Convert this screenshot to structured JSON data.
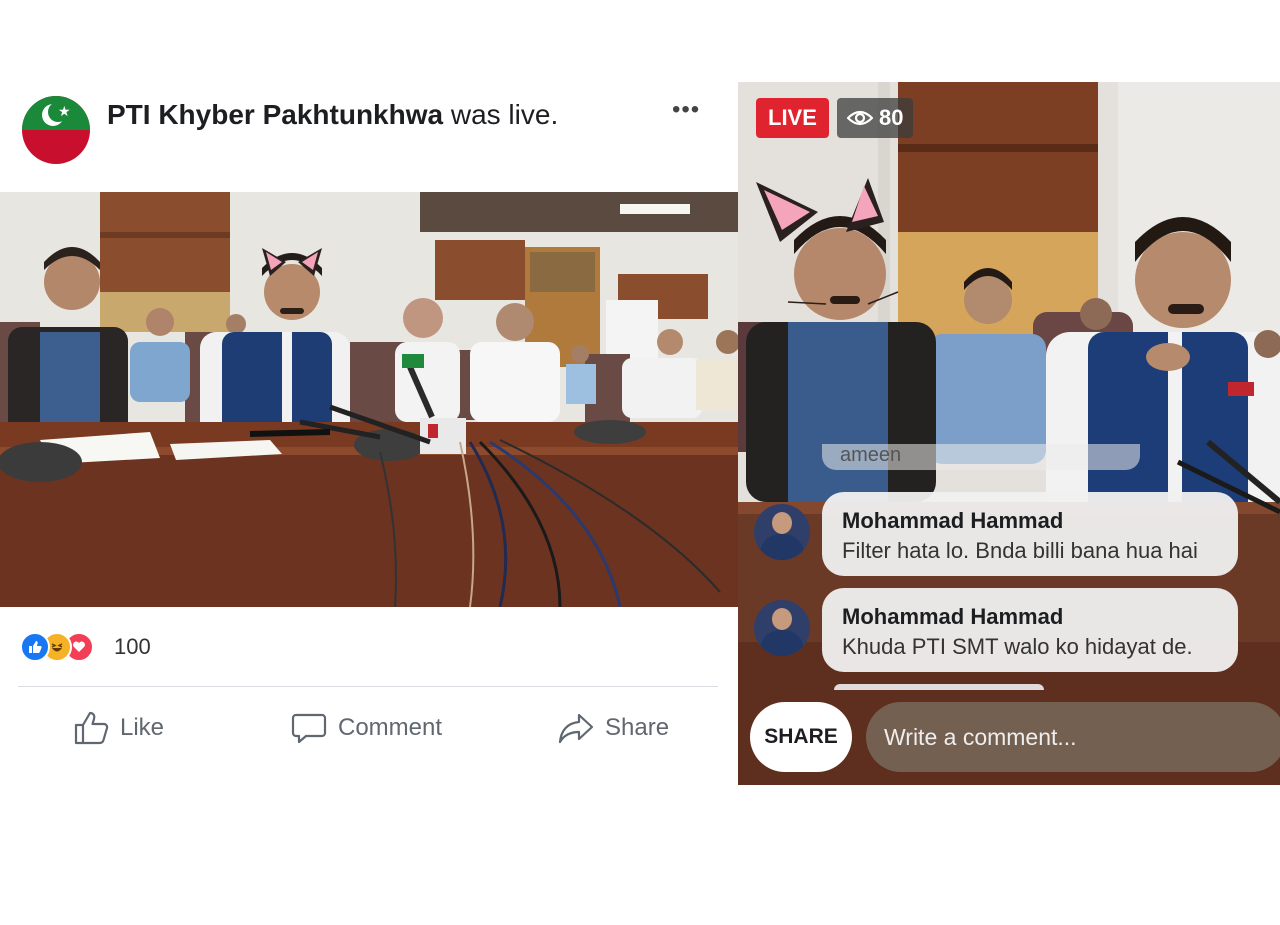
{
  "post": {
    "page_name": "PTI Khyber Pakhtunkhwa",
    "status_text": " was live.",
    "more_label": "•••",
    "reaction_count": "100",
    "actions": {
      "like": "Like",
      "comment": "Comment",
      "share": "Share"
    }
  },
  "live": {
    "badge": "LIVE",
    "viewers": "80",
    "faded_comment": "ameen",
    "comments": [
      {
        "name": "Mohammad Hammad",
        "text": "Filter hata lo. Bnda billi bana hua hai"
      },
      {
        "name": "Mohammad Hammad",
        "text": "Khuda PTI SMT walo ko hidayat de."
      }
    ],
    "share_label": "SHARE",
    "comment_placeholder": "Write a comment..."
  },
  "colors": {
    "facebook_blue": "#1877f2",
    "live_red": "#e0242f",
    "love_red": "#f33e58",
    "haha_yellow": "#f7b125",
    "pti_green": "#1a8a3a",
    "pti_red": "#c8102e"
  },
  "icons": [
    "more-icon",
    "like-reaction-icon",
    "haha-reaction-icon",
    "love-reaction-icon",
    "thumb-icon",
    "speech-bubble-icon",
    "share-arrow-icon",
    "eye-icon"
  ]
}
